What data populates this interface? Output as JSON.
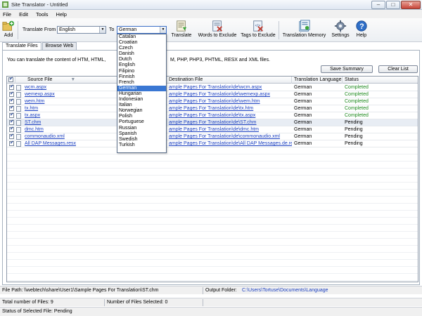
{
  "window": {
    "title": "Site Translator - Untitled"
  },
  "menu": [
    "File",
    "Edit",
    "Tools",
    "Help"
  ],
  "toolbar": {
    "add": "Add",
    "translate_from_label": "Translate From",
    "from_value": "English",
    "to_label": "To",
    "to_value": "German",
    "translate": "Translate",
    "words_to_exclude": "Words to Exclude",
    "tags_to_exclude": "Tags to Exclude",
    "translation_memory": "Translation Memory",
    "settings": "Settings",
    "help": "Help"
  },
  "tabs": [
    "Translate Files",
    "Browse Web"
  ],
  "info_text": "You can translate the content of HTM, HTML,",
  "info_text_tail": "M, PHP, PHP3, PHTML, RESX and XML files.",
  "buttons": {
    "save_summary": "Save Summary",
    "clear_list": "Clear List"
  },
  "grid": {
    "columns": [
      "Source File",
      "Destination File",
      "Translation Language",
      "Status"
    ],
    "rows": [
      {
        "checked": true,
        "source": "wcm.aspx",
        "dest": "ample Pages For Translation\\de\\wcm.aspx",
        "lang": "German",
        "status": "Completed"
      },
      {
        "checked": true,
        "source": "wemexp.aspx",
        "dest": "ample Pages For Translation\\de\\wemexp.aspx",
        "lang": "German",
        "status": "Completed"
      },
      {
        "checked": true,
        "source": "wem.htm",
        "dest": "ample Pages For Translation\\de\\wem.htm",
        "lang": "German",
        "status": "Completed"
      },
      {
        "checked": true,
        "source": "tx.htm",
        "dest": "ample Pages For Translation\\de\\tx.htm",
        "lang": "German",
        "status": "Completed"
      },
      {
        "checked": true,
        "source": "tx.aspx",
        "dest": "ample Pages For Translation\\de\\tx.aspx",
        "lang": "German",
        "status": "Completed"
      },
      {
        "checked": true,
        "source": "ST.chm",
        "dest": "ample Pages For Translation\\de\\ST.chm",
        "lang": "German",
        "status": "Pending",
        "selected": true
      },
      {
        "checked": true,
        "source": "dmc.htm",
        "dest": "ample Pages For Translation\\de\\dmc.htm",
        "lang": "German",
        "status": "Pending"
      },
      {
        "checked": true,
        "source": "commonaudio.xml",
        "dest": "ample Pages For Translation\\de\\commonaudio.xml",
        "lang": "German",
        "status": "Pending"
      },
      {
        "checked": true,
        "source": "All DAP Messages.resx",
        "dest": "ample Pages For Translation\\de\\All DAP Messages.de.resx",
        "lang": "German",
        "status": "Pending"
      }
    ]
  },
  "language_dropdown": {
    "selected": "German",
    "options": [
      "Catalan",
      "Croatian",
      "Czech",
      "Danish",
      "Dutch",
      "English",
      "Filipino",
      "Finnish",
      "French",
      "German",
      "Hungarian",
      "Indonesian",
      "Italian",
      "Norwegian",
      "Polish",
      "Portuguese",
      "Russian",
      "Spanish",
      "Swedish",
      "Turkish"
    ]
  },
  "status_bar": {
    "file_path_label": "File Path:",
    "file_path_value": "\\\\webtech\\share\\User1\\Sample Pages For Translation\\ST.chm",
    "output_folder_label": "Output Folder:",
    "output_folder_value": "C:\\Users\\Tortuse\\Documents\\Language",
    "total_files": "Total number of Files: 9",
    "files_selected": "Number of Files Selected: 0",
    "selected_status": "Status of Selected File: Pending"
  },
  "colors": {
    "accent": "#3a77d3",
    "completed": "#1e8a1e",
    "link": "#1a3fc0"
  }
}
